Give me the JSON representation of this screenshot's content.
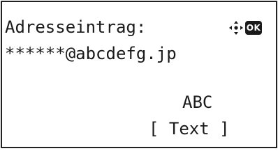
{
  "screen": {
    "title": "Adresseintrag:",
    "address_value": "******@abcdefg.jp",
    "input_mode": "ABC",
    "softkey_label": "[ Text ]"
  },
  "icons": {
    "navigation": "dpad-icon",
    "ok_label": "OK"
  }
}
